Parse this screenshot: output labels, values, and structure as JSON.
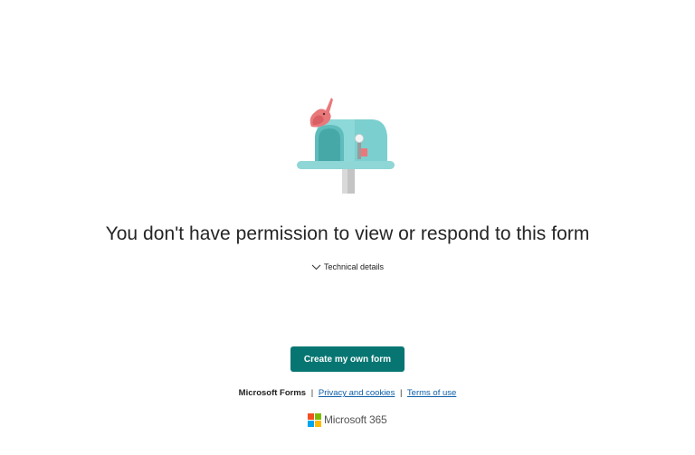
{
  "message": {
    "headline": "You don't have permission to view or respond to this form",
    "details_toggle_label": "Technical details",
    "details_icon": "chevron-down-icon"
  },
  "actions": {
    "create_button_label": "Create my own form"
  },
  "footer": {
    "brand": "Microsoft Forms",
    "separator": "|",
    "privacy_link": "Privacy and cookies",
    "terms_link": "Terms of use",
    "product_logo_text": "Microsoft 365",
    "logo_icon": "microsoft-logo-icon"
  },
  "illustration": {
    "icon": "mailbox-with-bird-icon"
  },
  "colors": {
    "primary_button": "#077672",
    "link": "#0f5ea8",
    "mailbox_teal": "#7fd0d0",
    "bird_red": "#e9787b",
    "ms_red": "#f25022",
    "ms_green": "#7fba00",
    "ms_blue": "#00a4ef",
    "ms_yellow": "#ffb900"
  }
}
